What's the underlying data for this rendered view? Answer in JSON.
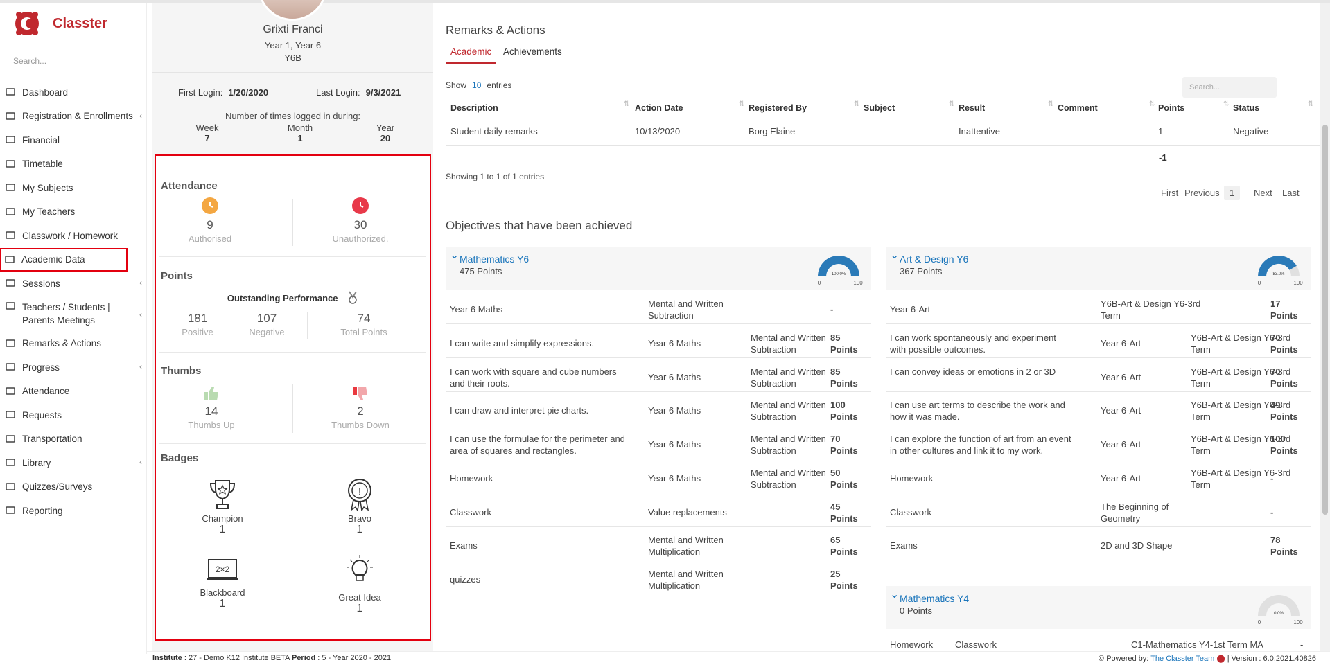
{
  "app": {
    "name": "Classter",
    "search_placeholder": "Search..."
  },
  "sidebar": {
    "items": [
      {
        "label": "Dashboard",
        "icon": "laptop-icon"
      },
      {
        "label": "Registration & Enrollments",
        "icon": "building-icon"
      },
      {
        "label": "Financial",
        "icon": "coins-icon"
      },
      {
        "label": "Timetable",
        "icon": "calendar-icon"
      },
      {
        "label": "My Subjects",
        "icon": "book-icon"
      },
      {
        "label": "My Teachers",
        "icon": "users-icon"
      },
      {
        "label": "Classwork / Homework",
        "icon": "list-icon"
      },
      {
        "label": "Academic Data",
        "icon": "id-card-icon"
      },
      {
        "label": "Sessions",
        "icon": "group-icon"
      },
      {
        "label": "Teachers / Students | Parents Meetings",
        "icon": "users-icon"
      },
      {
        "label": "Remarks & Actions",
        "icon": "random-icon"
      },
      {
        "label": "Progress",
        "icon": "graduation-cap-icon"
      },
      {
        "label": "Attendance",
        "icon": "user-check-icon"
      },
      {
        "label": "Requests",
        "icon": "file-icon"
      },
      {
        "label": "Transportation",
        "icon": "bus-icon"
      },
      {
        "label": "Library",
        "icon": "books-icon"
      },
      {
        "label": "Quizzes/Surveys",
        "icon": "clipboard-icon"
      },
      {
        "label": "Reporting",
        "icon": "print-icon"
      }
    ]
  },
  "profile": {
    "name": "Grixti Franci",
    "year": "Year 1, Year 6",
    "class": "Y6B",
    "first_login_label": "First Login:",
    "first_login": "1/20/2020",
    "last_login_label": "Last Login:",
    "last_login": "9/3/2021",
    "times_label": "Number of times logged in during:",
    "week_label": "Week",
    "week": "7",
    "month_label": "Month",
    "month": "1",
    "year_label": "Year",
    "year_count": "20"
  },
  "attendance": {
    "title": "Attendance",
    "authorised": "9",
    "authorised_label": "Authorised",
    "unauthorized": "30",
    "unauthorized_label": "Unauthorized."
  },
  "points": {
    "title": "Points",
    "performance": "Outstanding Performance",
    "positive": "181",
    "positive_label": "Positive",
    "negative": "107",
    "negative_label": "Negative",
    "total": "74",
    "total_label": "Total Points"
  },
  "thumbs": {
    "title": "Thumbs",
    "up": "14",
    "up_label": "Thumbs Up",
    "down": "2",
    "down_label": "Thumbs Down"
  },
  "badges": {
    "title": "Badges",
    "items": [
      {
        "name": "Champion",
        "count": "1",
        "icon": "trophy-icon"
      },
      {
        "name": "Bravo",
        "count": "1",
        "icon": "medal-icon"
      },
      {
        "name": "Blackboard",
        "count": "1",
        "icon": "blackboard-icon"
      },
      {
        "name": "Great Idea",
        "count": "1",
        "icon": "lightbulb-icon"
      }
    ]
  },
  "remarks": {
    "title": "Remarks & Actions",
    "tabs": [
      "Academic",
      "Achievements"
    ],
    "show": "Show",
    "entries_count": "10",
    "entries": "entries",
    "search_placeholder": "Search...",
    "columns": [
      "Description",
      "Action Date",
      "Registered By",
      "Subject",
      "Result",
      "Comment",
      "Points",
      "Status"
    ],
    "row": {
      "description": "Student daily remarks",
      "date": "10/13/2020",
      "by": "Borg Elaine",
      "subject": "",
      "result": "Inattentive",
      "comment": "",
      "points": "1",
      "status": "Negative"
    },
    "total": "-1",
    "showing": "Showing 1 to 1 of 1 entries",
    "pager": [
      "First",
      "Previous",
      "1",
      "Next",
      "Last"
    ]
  },
  "objectives": {
    "title": "Objectives that have been achieved",
    "left": {
      "subject": "Mathematics Y6",
      "points": "475 Points",
      "gauge": "100.0%",
      "gauge_value": 1.0,
      "rows": [
        [
          "Year 6 Maths",
          "Mental and Written Subtraction",
          "",
          "-",
          ""
        ],
        [
          "I can write and simplify expressions.",
          "Year 6 Maths",
          "Mental and Written Subtraction",
          "85",
          "Points"
        ],
        [
          "I can work with square and cube numbers and their roots.",
          "Year 6 Maths",
          "Mental and Written Subtraction",
          "85",
          "Points"
        ],
        [
          "I can draw and interpret pie charts.",
          "Year 6 Maths",
          "Mental and Written Subtraction",
          "100",
          "Points"
        ],
        [
          "I can use the formulae for the perimeter and area of squares and rectangles.",
          "Year 6 Maths",
          "Mental and Written Subtraction",
          "70",
          "Points"
        ],
        [
          "Homework",
          "Year 6 Maths",
          "Mental and Written Subtraction",
          "50",
          "Points"
        ],
        [
          "Classwork",
          "Value replacements",
          "",
          "45",
          "Points"
        ],
        [
          "Exams",
          "Mental and Written Multiplication",
          "",
          "65",
          "Points"
        ],
        [
          "quizzes",
          "Mental and Written Multiplication",
          "",
          "25",
          "Points"
        ]
      ]
    },
    "right": {
      "subject": "Art & Design Y6",
      "points": "367 Points",
      "gauge": "83.0%",
      "gauge_value": 0.83,
      "rows": [
        [
          "Year 6-Art",
          "Y6B-Art & Design Y6-3rd Term",
          "",
          "17",
          "Points"
        ],
        [
          "I can work spontaneously and experiment with possible outcomes.",
          "Year 6-Art",
          "Y6B-Art & Design Y6-3rd Term",
          "70",
          "Points"
        ],
        [
          "I can convey ideas or emotions in 2 or 3D",
          "Year 6-Art",
          "Y6B-Art & Design Y6-3rd Term",
          "70",
          "Points"
        ],
        [
          "I can use art terms to describe the work and how it was made.",
          "Year 6-Art",
          "Y6B-Art & Design Y6-3rd Term",
          "49",
          "Points"
        ],
        [
          "I can explore the function of art from an event in other cultures and link it to my work.",
          "Year 6-Art",
          "Y6B-Art & Design Y6-3rd Term",
          "100",
          "Points"
        ],
        [
          "Homework",
          "Year 6-Art",
          "Y6B-Art & Design Y6-3rd Term",
          "-",
          ""
        ],
        [
          "Classwork",
          "The Beginning of Geometry",
          "",
          "-",
          ""
        ],
        [
          "Exams",
          "2D and 3D Shape",
          "",
          "78",
          "Points"
        ]
      ]
    },
    "third": {
      "subject": "Mathematics Y4",
      "points": "0 Points",
      "gauge": "0.0%",
      "gauge_value": 0.0,
      "row": [
        "Homework",
        "Classwork",
        "C1-Mathematics Y4-1st Term MA",
        "-"
      ]
    },
    "gauge_min": "0",
    "gauge_max": "100"
  },
  "footer": {
    "institute_label": "Institute",
    "institute": ": 27 - Demo K12 Institute BETA",
    "period_label": "Period",
    "period": ": 5 - Year 2020 - 2021",
    "powered": "Powered by:",
    "team": "The Classter Team",
    "version": "| Version : 6.0.2021.40826"
  },
  "colors": {
    "brand": "#c0282e",
    "link": "#1a75bb",
    "highlight": "#e3000f",
    "gauge": "#2a7ab8"
  }
}
